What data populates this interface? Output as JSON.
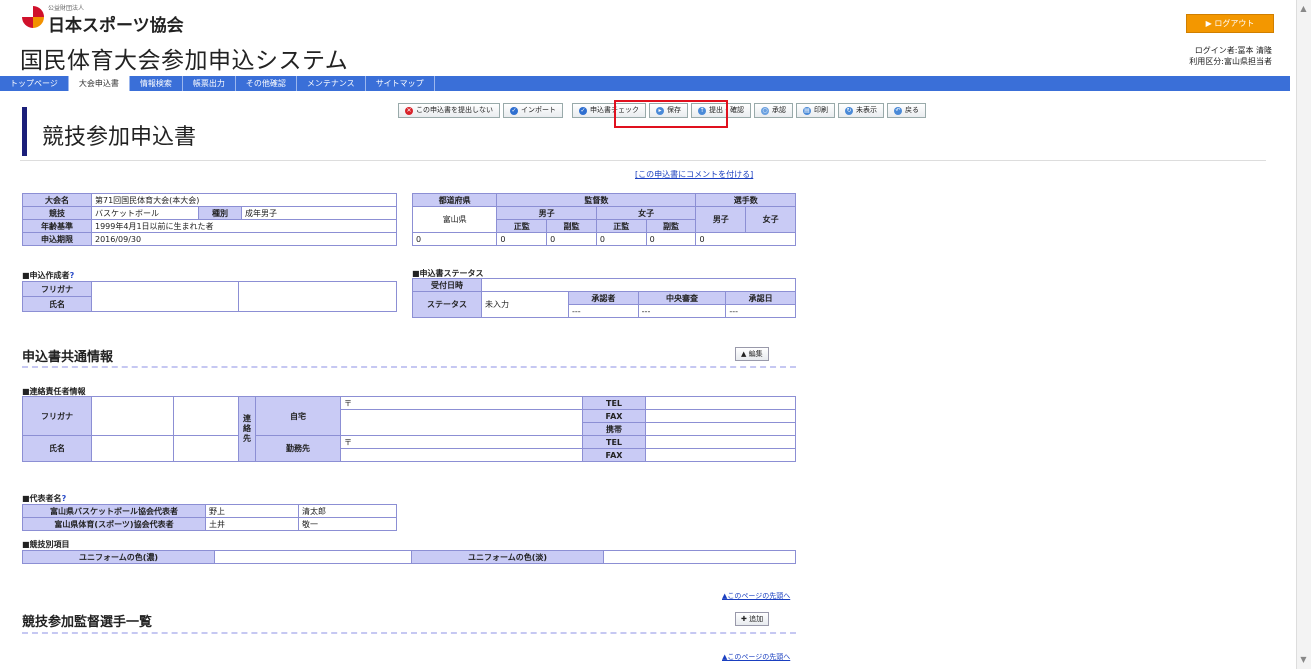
{
  "header": {
    "org_small": "公益財団法人",
    "org_name": "日本スポーツ協会",
    "system_title": "国民体育大会参加申込システム",
    "logout_label": "ログアウト",
    "user_line1": "ログイン者:冨本 清隆",
    "user_line2": "利用区分:富山県担当者"
  },
  "nav": [
    "トップページ",
    "大会申込書",
    "情報検索",
    "帳票出力",
    "その他確認",
    "メンテナンス",
    "サイトマップ"
  ],
  "page_title": "競技参加申込書",
  "toolbar": {
    "b1": "この申込書を提出しない",
    "b2": "インポート",
    "b3": "申込書チェック",
    "b4": "保存",
    "b5": "提出・確認",
    "b6": "承認",
    "b7": "印刷",
    "b8": "未表示",
    "b9": "戻る"
  },
  "comment_link": "[この申込書にコメントを付ける]",
  "info": {
    "r1_label": "大会名",
    "r1_value": "第71回国民体育大会(本大会)",
    "r2_label": "競技",
    "r2_value": "バスケットボール",
    "r2_label2": "種別",
    "r2_value2": "成年男子",
    "r3_label": "年齢基準",
    "r3_value": "1999年4月1日以前に生まれた者",
    "r4_label": "申込期限",
    "r4_value": "2016/09/30"
  },
  "counts": {
    "pref_header": "都道府県",
    "staff_header": "監督数",
    "players_header": "選手数",
    "male": "男子",
    "female": "女子",
    "main": "正監",
    "sub": "副監",
    "pref": "富山県",
    "values": [
      "0",
      "0",
      "0",
      "0",
      "0",
      "0"
    ]
  },
  "creator": {
    "label": "■申込作成者",
    "furigana": "フリガナ",
    "name": "氏名"
  },
  "status": {
    "label": "■申込書ステータス",
    "date_label": "受付日時",
    "status_label": "ステータス",
    "status_value": "未入力",
    "c1": "承認者",
    "c2": "中央審査",
    "c3": "承認日",
    "v1": "---",
    "v2": "---",
    "v3": "---"
  },
  "common": {
    "heading": "申込書共通情報",
    "edit_label": "編集",
    "contact_label": "■連絡責任者情報",
    "furigana": "フリガナ",
    "name": "氏名",
    "contact_vertical": "連絡先",
    "home": "自宅",
    "work": "勤務先",
    "postal1": "〒",
    "postal2": "〒",
    "tel": "TEL",
    "fax": "FAX",
    "mobile": "携帯",
    "tel2": "TEL",
    "fax2": "FAX"
  },
  "reps": {
    "label": "■代表者名",
    "r1_label": "富山県バスケットボール協会代表者",
    "r1_sei": "野上",
    "r1_mei": "清太郎",
    "r2_label": "富山県体育(スポーツ)協会代表者",
    "r2_sei": "土井",
    "r2_mei": "敬一"
  },
  "uniform": {
    "label": "■競技別項目",
    "c1": "ユニフォームの色(濃)",
    "c2": "ユニフォームの色(淡)"
  },
  "top_link": "▲このページの先頭へ",
  "players": {
    "heading": "競技参加監督選手一覧",
    "add_label": "追加"
  },
  "top_link2": "▲このページの先頭へ"
}
